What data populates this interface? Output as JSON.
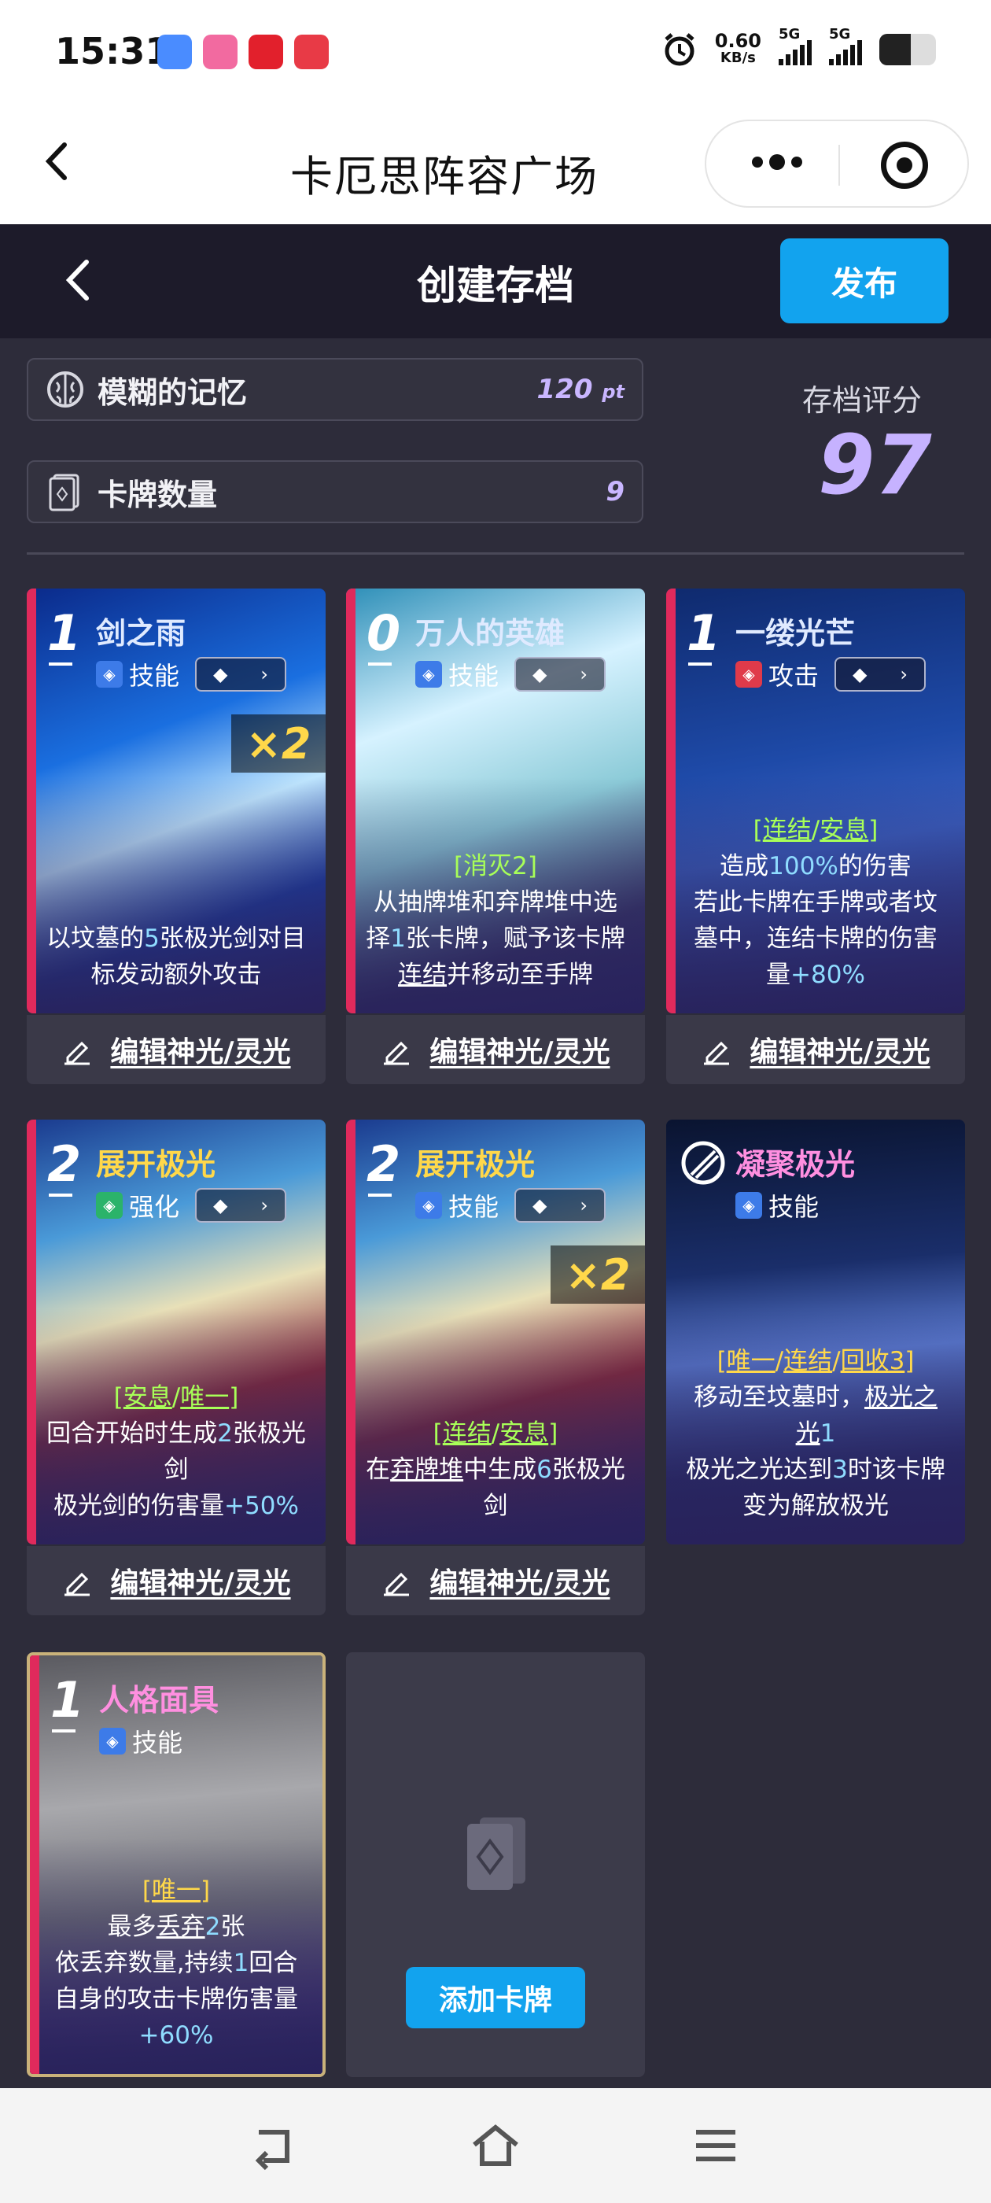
{
  "status_bar": {
    "time": "15:31",
    "speed_value": "0.60",
    "speed_unit": "KB/s",
    "net1": "5G",
    "net2": "5G"
  },
  "nav": {
    "title": "卡厄思阵容广场",
    "back_icon": "chevron-left-icon",
    "more_icon": "more-dots-icon",
    "close_icon": "target-circle-icon"
  },
  "header": {
    "title": "创建存档",
    "publish_label": "发布"
  },
  "info": {
    "memory_label": "模糊的记忆",
    "memory_value": "120",
    "memory_unit": "pt",
    "cards_label": "卡牌数量",
    "cards_value": "9",
    "score_label": "存档评分",
    "score_value": "97"
  },
  "cards": [
    {
      "cost": "1",
      "name": "剑之雨",
      "type": "技能",
      "multiplier": "×2",
      "desc_html": "以坟墓的<span class='num'>5</span>张极光剑对目标发动额外攻击",
      "edit_label": "编辑神光/灵光"
    },
    {
      "cost": "0",
      "name": "万人的英雄",
      "type": "技能",
      "multiplier": "",
      "desc_html": "<span class='kw'>[消灭2]</span><br>从抽牌堆和弃牌堆中选择<span class='num'>1</span>张卡牌，赋予该卡牌<u>连结</u>并移动至手牌",
      "edit_label": "编辑神光/灵光"
    },
    {
      "cost": "1",
      "name": "一缕光芒",
      "type": "攻击",
      "multiplier": "",
      "desc_html": "<span class='kw'>[<u>连结</u>/<u>安息</u>]</span><br>造成<span class='num'>100%</span>的伤害<br>若此卡牌在手牌或者坟墓中，连结卡牌的伤害量<span class='num'>+80%</span>",
      "edit_label": "编辑神光/灵光"
    },
    {
      "cost": "2",
      "name": "展开极光",
      "type": "强化",
      "multiplier": "",
      "desc_html": "<span class='kw'>[<u>安息</u>/<u>唯一</u>]</span><br>回合开始时生成<span class='num'>2</span>张极光剑<br>极光剑的伤害量<span class='num'>+50%</span>",
      "edit_label": "编辑神光/灵光"
    },
    {
      "cost": "2",
      "name": "展开极光",
      "type": "技能",
      "multiplier": "×2",
      "desc_html": "<span class='kw'>[<u>连结</u>/<u>安息</u>]</span><br>在<u>弃牌堆</u>中生成<span class='num'>6</span>张极光剑",
      "edit_label": "编辑神光/灵光"
    },
    {
      "cost": "",
      "name": "凝聚极光",
      "type": "技能",
      "multiplier": "",
      "desc_html": "<span style='color:#ffd84a'>[<u>唯一</u>/<u>连结</u>/<u>回收3</u>]</span><br>移动至坟墓时，<u>极光之光</u><span class='num'>1</span><br>极光之光达到<span class='num'>3</span>时该卡牌变为解放极光",
      "edit_label": ""
    },
    {
      "cost": "1",
      "name": "人格面具",
      "type": "技能",
      "multiplier": "",
      "desc_html": "<span style='color:#ffd84a'>[<u>唯一</u>]</span><br>最多<u>丢弃</u><span class='num'>2</span>张<br>依丢弃数量,持续<span class='num'>1</span>回合自身的攻击卡牌伤害量<br><span class='num'>+60%</span>",
      "edit_label": ""
    }
  ],
  "add_card_label": "添加卡牌",
  "bottom_nav": {
    "back_icon": "return-icon",
    "home_icon": "home-icon",
    "menu_icon": "menu-icon"
  }
}
